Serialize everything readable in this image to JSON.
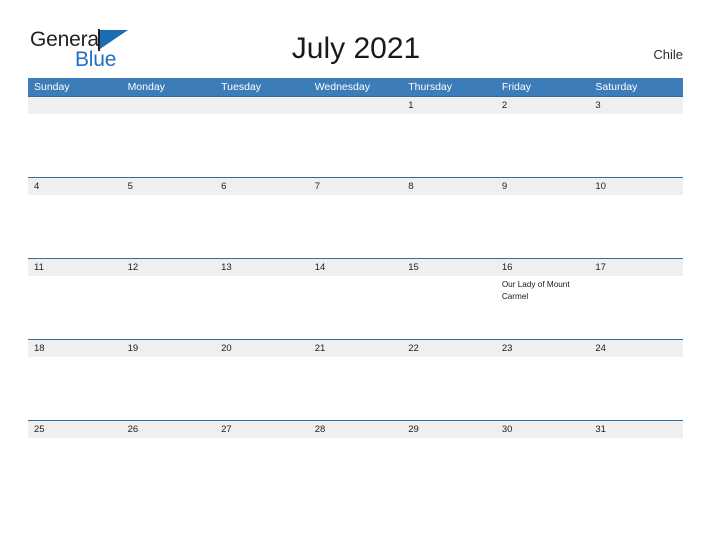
{
  "brand": {
    "name_part1": "General",
    "name_part2": "Blue",
    "flag_icon": "blue-triangle-flag-icon",
    "color_dark": "#231f20",
    "color_blue": "#1f6fc4"
  },
  "header": {
    "title": "July 2021",
    "country": "Chile"
  },
  "theme": {
    "header_blue": "#3c7cb8",
    "date_band_gray": "#efefef",
    "row_border_blue": "#2e6da4",
    "cell_white": "#ffffff",
    "text_dark": "#222222"
  },
  "calendar": {
    "weekdays": [
      "Sunday",
      "Monday",
      "Tuesday",
      "Wednesday",
      "Thursday",
      "Friday",
      "Saturday"
    ],
    "weeks": [
      {
        "dates": [
          "",
          "",
          "",
          "",
          "1",
          "2",
          "3"
        ],
        "events": [
          "",
          "",
          "",
          "",
          "",
          "",
          ""
        ]
      },
      {
        "dates": [
          "4",
          "5",
          "6",
          "7",
          "8",
          "9",
          "10"
        ],
        "events": [
          "",
          "",
          "",
          "",
          "",
          "",
          ""
        ]
      },
      {
        "dates": [
          "11",
          "12",
          "13",
          "14",
          "15",
          "16",
          "17"
        ],
        "events": [
          "",
          "",
          "",
          "",
          "",
          "Our Lady of Mount Carmel",
          ""
        ]
      },
      {
        "dates": [
          "18",
          "19",
          "20",
          "21",
          "22",
          "23",
          "24"
        ],
        "events": [
          "",
          "",
          "",
          "",
          "",
          "",
          ""
        ]
      },
      {
        "dates": [
          "25",
          "26",
          "27",
          "28",
          "29",
          "30",
          "31"
        ],
        "events": [
          "",
          "",
          "",
          "",
          "",
          "",
          ""
        ]
      }
    ]
  }
}
